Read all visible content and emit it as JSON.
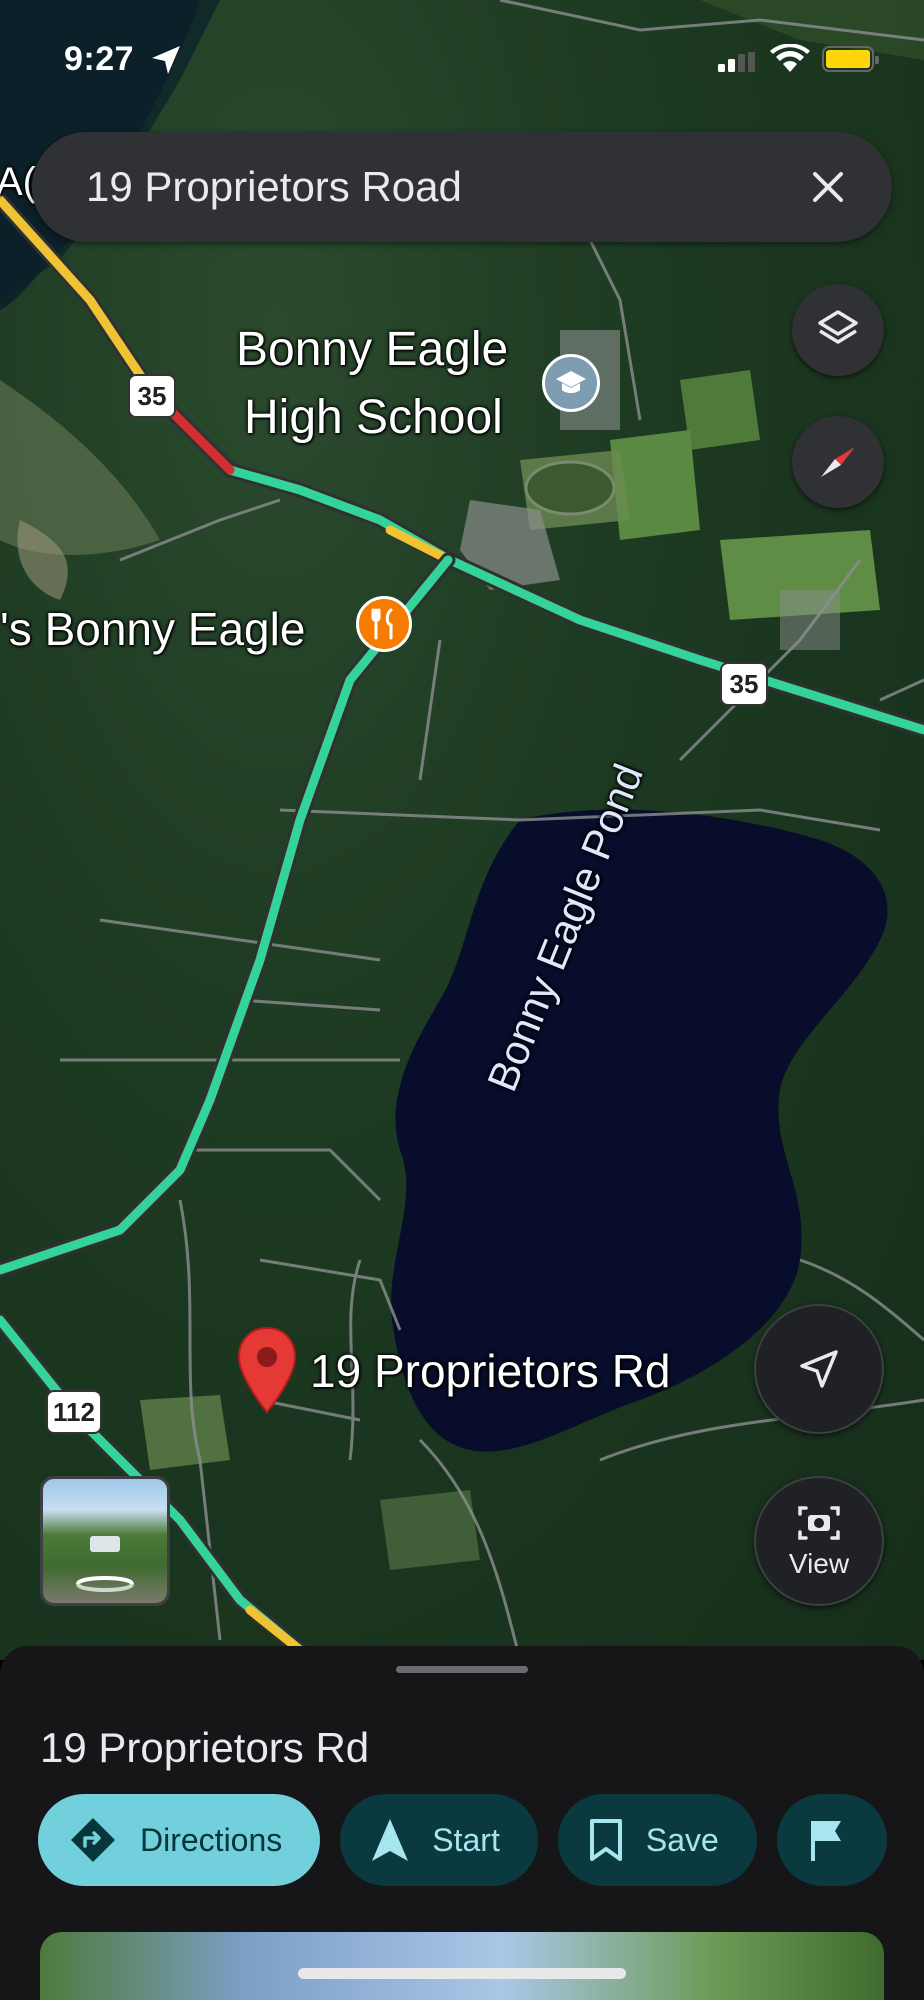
{
  "status_bar": {
    "time": "9:27"
  },
  "search": {
    "query": "19 Proprietors Road"
  },
  "map": {
    "labels": {
      "school_line1": "Bonny Eagle",
      "school_line2": "High School",
      "restaurant": "'s Bonny Eagle",
      "pond": "Bonny Eagle Pond",
      "pin": "19 Proprietors Rd",
      "edge_fragment": "A("
    },
    "route_shields": [
      "35",
      "35",
      "112"
    ]
  },
  "buttons": {
    "view_label": "View"
  },
  "sheet": {
    "title": "19 Proprietors Rd",
    "chips": [
      {
        "label": "Directions"
      },
      {
        "label": "Start"
      },
      {
        "label": "Save"
      }
    ]
  },
  "colors": {
    "primary_chip": "#72cfdc",
    "chip": "#0a3a40",
    "road_green": "#34d399",
    "pin_red": "#e53935",
    "restaurant": "#f57c00"
  },
  "icons": [
    "location-arrow-icon",
    "signal-icon",
    "wifi-icon",
    "battery-icon",
    "close-icon",
    "layers-icon",
    "compass-icon",
    "school-icon",
    "restaurant-icon",
    "map-pin-icon",
    "my-location-icon",
    "lens-icon",
    "street-view-icon",
    "directions-icon",
    "navigation-icon",
    "bookmark-icon",
    "flag-icon"
  ]
}
